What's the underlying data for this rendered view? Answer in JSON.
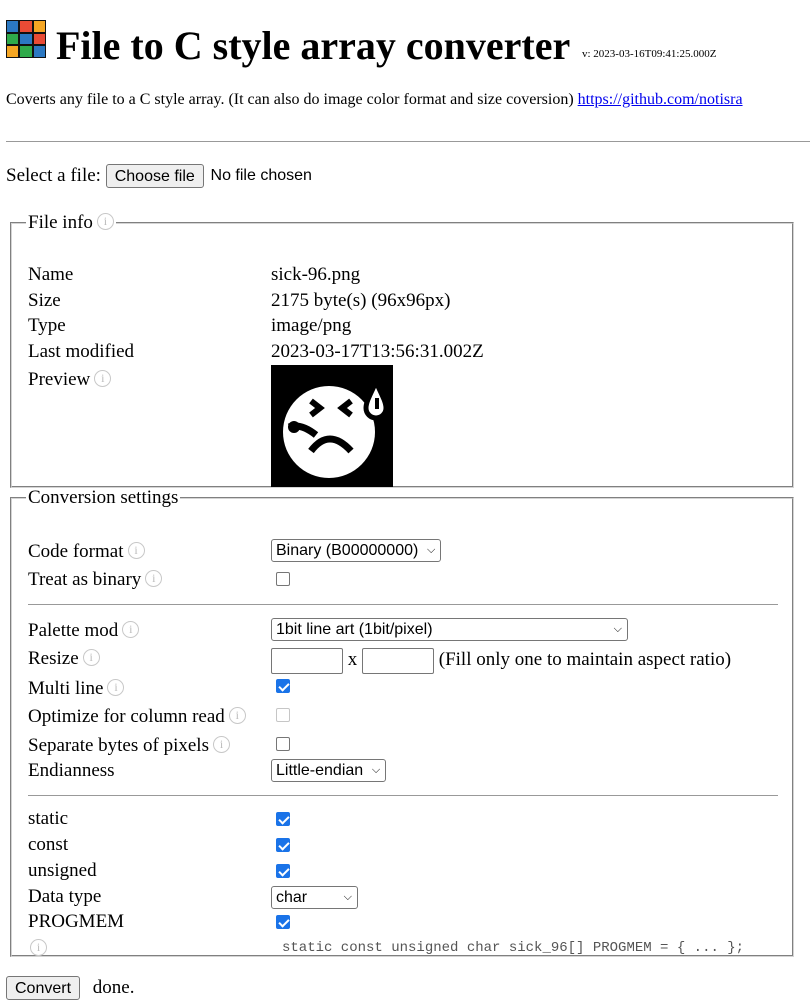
{
  "header": {
    "title": "File to C style array converter",
    "version": "v: 2023-03-16T09:41:25.000Z",
    "logo_colors": [
      "#2b78c2",
      "#e94b35",
      "#f5a623",
      "#2faa4a",
      "#2b78c2",
      "#e94b35",
      "#f5a623",
      "#2faa4a",
      "#2b78c2"
    ]
  },
  "description": {
    "text": "Coverts any file to a C style array. (It can also do image color format and size coversion)",
    "link": "https://github.com/notisra"
  },
  "file_select": {
    "label": "Select a file:",
    "button": "Choose file",
    "status": "No file chosen"
  },
  "file_info": {
    "legend": "File info",
    "rows": [
      {
        "label": "Name",
        "value": "sick-96.png"
      },
      {
        "label": "Size",
        "value": "2175 byte(s) (96x96px)"
      },
      {
        "label": "Type",
        "value": "image/png"
      },
      {
        "label": "Last modified",
        "value": "2023-03-17T13:56:31.002Z"
      }
    ],
    "preview_label": "Preview"
  },
  "conversion": {
    "legend": "Conversion settings",
    "code_format": {
      "label": "Code format",
      "value": "Binary (B00000000)"
    },
    "treat_binary": {
      "label": "Treat as binary",
      "checked": false
    },
    "palette_mod": {
      "label": "Palette mod",
      "value": "1bit line art (1bit/pixel)"
    },
    "resize": {
      "label": "Resize",
      "separator": "x",
      "hint": "(Fill only one to maintain aspect ratio)"
    },
    "multi_line": {
      "label": "Multi line",
      "checked": true
    },
    "optimize_column": {
      "label": "Optimize for column read",
      "checked": false,
      "disabled": true
    },
    "separate_bytes": {
      "label": "Separate bytes of pixels",
      "checked": false
    },
    "endianness": {
      "label": "Endianness",
      "value": "Little-endian"
    },
    "static": {
      "label": "static",
      "checked": true
    },
    "const": {
      "label": "const",
      "checked": true
    },
    "unsigned": {
      "label": "unsigned",
      "checked": true
    },
    "data_type": {
      "label": "Data type",
      "value": "char"
    },
    "progmem": {
      "label": "PROGMEM",
      "checked": true
    },
    "code_preview": "static const unsigned char sick_96[] PROGMEM = { ... };"
  },
  "actions": {
    "convert": "Convert",
    "status": "done."
  },
  "icons": {
    "info": "i"
  }
}
